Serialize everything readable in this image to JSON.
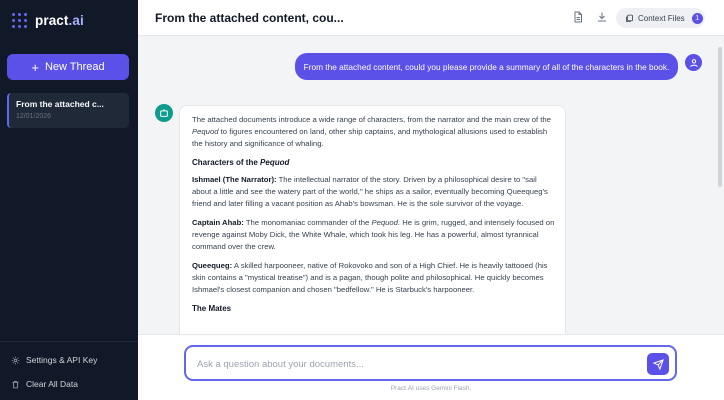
{
  "app": {
    "logo_name": "pract",
    "logo_suffix": ".ai"
  },
  "sidebar": {
    "new_thread_label": "New Thread",
    "threads": [
      {
        "title": "From the attached c...",
        "date": "12/01/2026"
      }
    ],
    "settings_label": "Settings & API Key",
    "clear_label": "Clear All Data"
  },
  "header": {
    "title": "From the attached content, cou...",
    "context_files_label": "Context Files",
    "context_files_count": "1"
  },
  "chat": {
    "user_message": "From the attached content, could you please provide a summary of all of the characters in the book.",
    "assistant": {
      "intro_1": "The attached documents introduce a wide range of characters, from the narrator and the main crew of the ",
      "intro_pequod": "Pequod",
      "intro_2": " to figures encountered on land, other ship captains, and mythological allusions used to establish the history and significance of whaling.",
      "section_heading_1": "Characters of the ",
      "section_heading_pequod": "Pequod",
      "characters": [
        {
          "name": "Ishmael (The Narrator):",
          "text": " The intellectual narrator of the story. Driven by a philosophical desire to \"sail about a little and see the watery part of the world,\" he ships as a sailor, eventually becoming Queequeg's friend and later filling a vacant position as Ahab's bowsman. He is the sole survivor of the voyage."
        },
        {
          "name": "Captain Ahab:",
          "text_1": " The monomaniac commander of the ",
          "text_pequod": "Pequod.",
          "text_2": " He is grim, rugged, and intensely focused on revenge against Moby Dick, the White Whale, which took his leg. He has a powerful, almost tyrannical command over the crew."
        },
        {
          "name": "Queequeg:",
          "text": " A skilled harpooneer, native of Rokovoko and son of a High Chief. He is heavily tattooed (his skin contains a \"mystical treatise\") and is a pagan, though polite and philosophical. He quickly becomes Ishmael's closest companion and chosen \"bedfellow.\" He is Starbuck's harpooneer."
        }
      ],
      "section_heading_2": "The Mates"
    }
  },
  "input": {
    "placeholder": "Ask a question about your documents...",
    "footnote": "Pract.AI uses Gemini Flash."
  },
  "colors": {
    "accent": "#5b50e8",
    "sidebar_bg": "#111827",
    "bot_avatar": "#0f9b8e"
  }
}
